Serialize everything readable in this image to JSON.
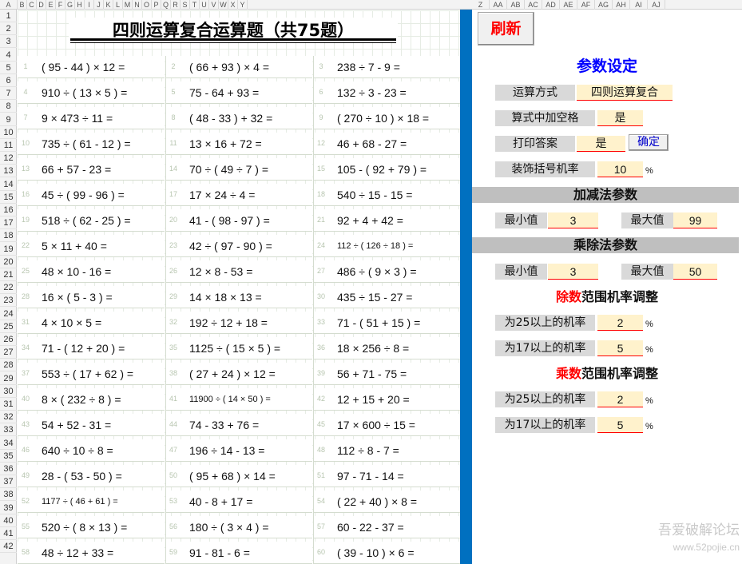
{
  "column_letters": [
    "A",
    "B",
    "C",
    "D",
    "E",
    "F",
    "G",
    "H",
    "I",
    "J",
    "K",
    "L",
    "M",
    "N",
    "O",
    "P",
    "Q",
    "R",
    "S",
    "T",
    "U",
    "V",
    "W",
    "X",
    "Y",
    "Z",
    "AA",
    "AB",
    "AC",
    "AD",
    "AE",
    "AF",
    "AG",
    "AH",
    "AI",
    "AJ"
  ],
  "row_numbers": [
    "1",
    "2",
    "3",
    "4",
    "5",
    "6",
    "7",
    "8",
    "9",
    "10",
    "11",
    "12",
    "13",
    "14",
    "15",
    "16",
    "17",
    "18",
    "19",
    "20",
    "21",
    "22",
    "23",
    "24",
    "25",
    "26",
    "27",
    "28",
    "29",
    "30",
    "31",
    "32",
    "33",
    "34",
    "35",
    "36",
    "37",
    "38",
    "39",
    "40",
    "41",
    "42"
  ],
  "title": "四则运算复合运算题（共75题）",
  "questions": [
    {
      "num": "1",
      "text": "( 95 - 44 ) × 12 ="
    },
    {
      "num": "2",
      "text": "( 66 + 93 ) × 4 ="
    },
    {
      "num": "3",
      "text": "238 ÷ 7 - 9 ="
    },
    {
      "num": "4",
      "text": "910 ÷ ( 13 × 5 ) ="
    },
    {
      "num": "5",
      "text": "75 - 64 + 93 ="
    },
    {
      "num": "6",
      "text": "132 ÷ 3 - 23 ="
    },
    {
      "num": "7",
      "text": "9 × 473 ÷ 11 ="
    },
    {
      "num": "8",
      "text": "( 48 - 33 ) + 32 ="
    },
    {
      "num": "9",
      "text": "( 270 ÷ 10 ) × 18 ="
    },
    {
      "num": "10",
      "text": "735 ÷ ( 61 - 12 ) ="
    },
    {
      "num": "11",
      "text": "13 × 16 + 72 ="
    },
    {
      "num": "12",
      "text": "46 + 68 - 27 ="
    },
    {
      "num": "13",
      "text": "66 + 57 - 23 ="
    },
    {
      "num": "14",
      "text": "70 ÷ ( 49 ÷ 7 ) ="
    },
    {
      "num": "15",
      "text": "105 - ( 92 + 79 ) ="
    },
    {
      "num": "16",
      "text": "45 ÷ ( 99 - 96 ) ="
    },
    {
      "num": "17",
      "text": "17 × 24 ÷ 4 ="
    },
    {
      "num": "18",
      "text": "540 ÷ 15 - 15 ="
    },
    {
      "num": "19",
      "text": "518 ÷ ( 62 - 25 ) ="
    },
    {
      "num": "20",
      "text": "41 - ( 98 - 97 ) ="
    },
    {
      "num": "21",
      "text": "92 + 4 + 42 ="
    },
    {
      "num": "22",
      "text": "5 × 11 + 40 ="
    },
    {
      "num": "23",
      "text": "42 ÷ ( 97 - 90 ) ="
    },
    {
      "num": "24",
      "text": "112 ÷ ( 126 ÷ 18 ) =",
      "small": true
    },
    {
      "num": "25",
      "text": "48 × 10 - 16 ="
    },
    {
      "num": "26",
      "text": "12 × 8 - 53 ="
    },
    {
      "num": "27",
      "text": "486 ÷ ( 9 × 3 ) ="
    },
    {
      "num": "28",
      "text": "16 × ( 5 - 3 ) ="
    },
    {
      "num": "29",
      "text": "14 × 18 × 13 ="
    },
    {
      "num": "30",
      "text": "435 ÷ 15 - 27 ="
    },
    {
      "num": "31",
      "text": "4 × 10 × 5 ="
    },
    {
      "num": "32",
      "text": "192 ÷ 12 + 18 ="
    },
    {
      "num": "33",
      "text": "71 - ( 51 + 15 ) ="
    },
    {
      "num": "34",
      "text": "71 - ( 12 + 20 ) ="
    },
    {
      "num": "35",
      "text": "1125 ÷ ( 15 × 5 ) ="
    },
    {
      "num": "36",
      "text": "18 × 256 ÷ 8 ="
    },
    {
      "num": "37",
      "text": "553 ÷ ( 17 + 62 ) ="
    },
    {
      "num": "38",
      "text": "( 27 + 24 ) × 12 ="
    },
    {
      "num": "39",
      "text": "56 + 71 - 75 ="
    },
    {
      "num": "40",
      "text": "8 × ( 232 ÷ 8 ) ="
    },
    {
      "num": "41",
      "text": "11900 ÷ ( 14 × 50 ) =",
      "small": true
    },
    {
      "num": "42",
      "text": "12 + 15 + 20 ="
    },
    {
      "num": "43",
      "text": "54 + 52 - 31 ="
    },
    {
      "num": "44",
      "text": "74 - 33 + 76 ="
    },
    {
      "num": "45",
      "text": "17 × 600 ÷ 15 ="
    },
    {
      "num": "46",
      "text": "640 ÷ 10 ÷ 8 ="
    },
    {
      "num": "47",
      "text": "196 ÷ 14 - 13 ="
    },
    {
      "num": "48",
      "text": "112 ÷ 8 - 7 ="
    },
    {
      "num": "49",
      "text": "28 - ( 53 - 50 ) ="
    },
    {
      "num": "50",
      "text": "( 95 + 68 ) × 14 ="
    },
    {
      "num": "51",
      "text": "97 - 71 - 14 ="
    },
    {
      "num": "52",
      "text": "1177 ÷ ( 46 + 61 ) =",
      "small": true
    },
    {
      "num": "53",
      "text": "40 - 8 + 17 ="
    },
    {
      "num": "54",
      "text": "( 22 + 40 ) × 8 ="
    },
    {
      "num": "55",
      "text": "520 ÷ ( 8 × 13 ) ="
    },
    {
      "num": "56",
      "text": "180 ÷ ( 3 × 4 ) ="
    },
    {
      "num": "57",
      "text": "60 - 22 - 37 ="
    },
    {
      "num": "58",
      "text": "48 ÷ 12 + 33 ="
    },
    {
      "num": "59",
      "text": "91 - 81 - 6 ="
    },
    {
      "num": "60",
      "text": "( 39 - 10 ) × 6 ="
    }
  ],
  "panel": {
    "refresh_label": "刷新",
    "title": "参数设定",
    "op_mode_label": "运算方式",
    "op_mode_value": "四则运算复合",
    "space_label": "算式中加空格",
    "space_value": "是",
    "print_answer_label": "打印答案",
    "print_answer_value": "是",
    "confirm_label": "确定",
    "bracket_rate_label": "装饰括号机率",
    "bracket_rate_value": "10",
    "percent": "%",
    "add_sub_header": "加减法参数",
    "add_min_label": "最小值",
    "add_min_value": "3",
    "add_max_label": "最大值",
    "add_max_value": "99",
    "mul_div_header": "乘除法参数",
    "mul_min_label": "最小值",
    "mul_min_value": "3",
    "mul_max_label": "最大值",
    "mul_max_value": "50",
    "divisor_adjust_prefix": "除数",
    "divisor_adjust_suffix": "范围机率调整",
    "div_over25_label": "为25以上的机率",
    "div_over25_value": "2",
    "div_over17_label": "为17以上的机率",
    "div_over17_value": "5",
    "multiplier_adjust_prefix": "乘数",
    "multiplier_adjust_suffix": "范围机率调整",
    "mul_over25_label": "为25以上的机率",
    "mul_over25_value": "2",
    "mul_over17_label": "为17以上的机率",
    "mul_over17_value": "5"
  },
  "watermark": {
    "line1": "吾爱破解论坛",
    "line2": "www.52pojie.cn"
  },
  "colors": {
    "accent_blue": "#0070c0",
    "title_blue": "#0000ff",
    "refresh_red": "#ff0000",
    "input_fill": "#fff2cc",
    "section_gray": "#bfbfbf",
    "label_gray": "#d9d9d9"
  }
}
